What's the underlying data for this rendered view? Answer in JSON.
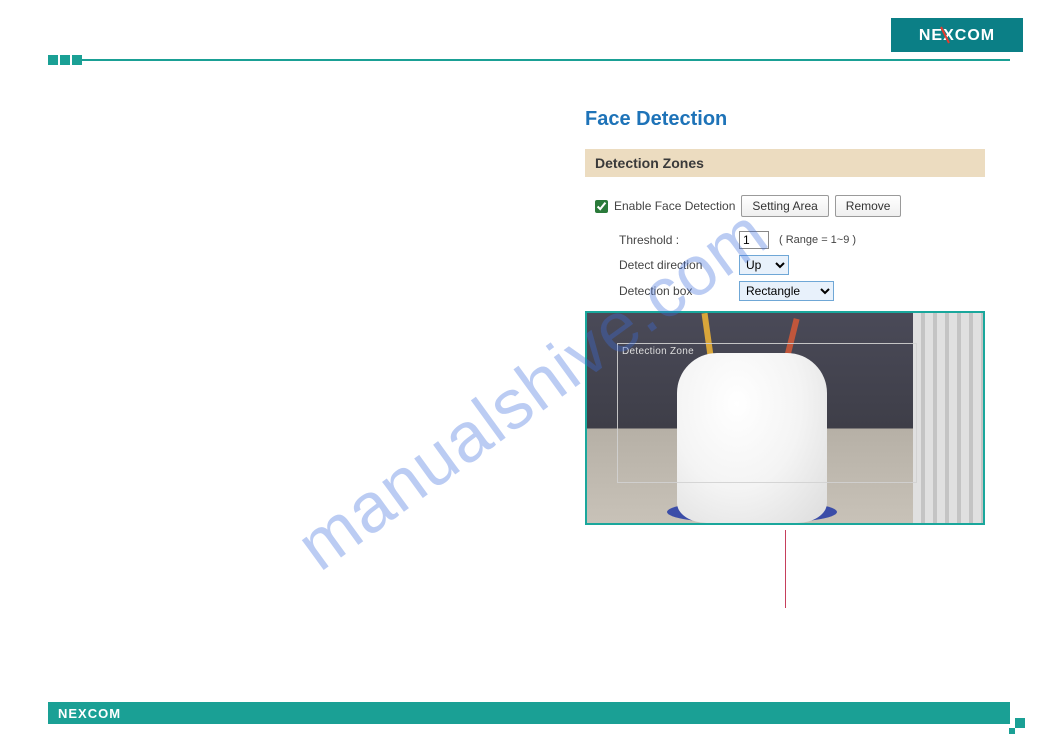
{
  "brand": {
    "name": "NEXCOM"
  },
  "page": {
    "title": "Face Detection",
    "section_header": "Detection Zones",
    "enable_label": "Enable Face Detection",
    "enable_checked": true,
    "buttons": {
      "setting_area": "Setting Area",
      "remove": "Remove"
    },
    "fields": {
      "threshold_label": "Threshold :",
      "threshold_value": "1",
      "threshold_range": "( Range = 1~9 )",
      "direction_label": "Detect direction",
      "direction_value": "Up",
      "box_label": "Detection box",
      "box_value": "Rectangle"
    },
    "preview": {
      "zone_label": "Detection Zone"
    }
  },
  "watermark": "manualshive.com",
  "footer": {
    "brand": "NEXCOM"
  }
}
